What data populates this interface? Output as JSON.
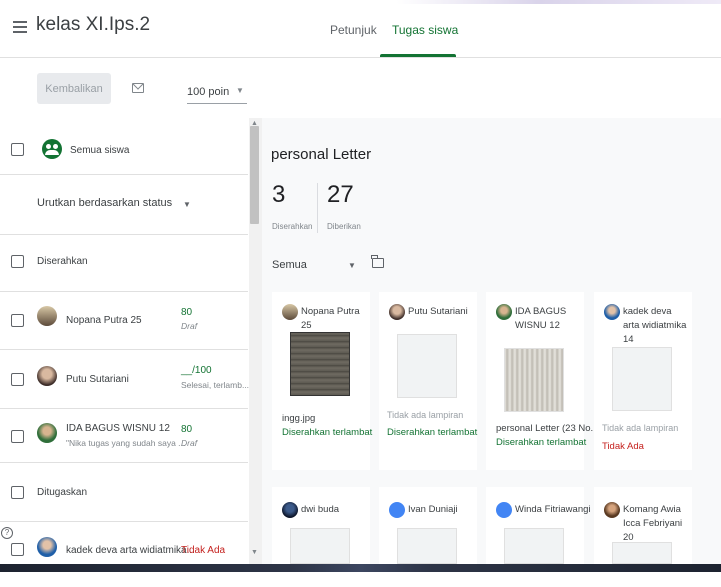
{
  "header": {
    "class_title": "kelas XI.Ips.2",
    "tabs": [
      {
        "label": "Petunjuk",
        "active": false
      },
      {
        "label": "Tugas siswa",
        "active": true
      }
    ]
  },
  "toolbar": {
    "return_label": "Kembalikan",
    "points": "100 poin"
  },
  "left_panel": {
    "all_students_label": "Semua siswa",
    "sort_label": "Urutkan berdasarkan status",
    "section_submitted": "Diserahkan",
    "section_assigned": "Ditugaskan",
    "students": [
      {
        "name": "Nopana Putra 25",
        "sub": "",
        "grade": "80",
        "grade_sub": "Draf"
      },
      {
        "name": "Putu Sutariani",
        "sub": "",
        "grade": "__/100",
        "grade_sub": "Selesai, terlamb..."
      },
      {
        "name": "IDA BAGUS WISNU 12",
        "sub": "\"Nika tugas yang sudah saya ...",
        "grade": "80",
        "grade_sub": "Draf"
      },
      {
        "name": "kadek deva arta widiatmika...",
        "sub": "",
        "grade": "Tidak Ada",
        "grade_sub": ""
      }
    ]
  },
  "right_panel": {
    "assignment_title": "personal Letter",
    "submitted_count": "3",
    "submitted_label": "Diserahkan",
    "assigned_count": "27",
    "assigned_label": "Diberikan",
    "filter": "Semua",
    "cards": [
      {
        "name": "Nopana Putra 25",
        "file": "ingg.jpg",
        "note": "",
        "status": "Diserahkan terlambat",
        "status_color": "#137333"
      },
      {
        "name": "Putu Sutariani",
        "file": "",
        "note": "Tidak ada lampiran",
        "status": "Diserahkan terlambat",
        "status_color": "#137333"
      },
      {
        "name": "IDA BAGUS WISNU 12",
        "file": "personal Letter (23 No...",
        "note": "",
        "status": "Diserahkan terlambat",
        "status_color": "#137333"
      },
      {
        "name": "kadek deva arta widiatmika 14",
        "file": "",
        "note": "Tidak ada lampiran",
        "status": "Tidak Ada",
        "status_color": "#c5221f"
      },
      {
        "name": "dwi buda",
        "file": "",
        "note": "",
        "status": "",
        "status_color": "#137333"
      },
      {
        "name": "Ivan Duniaji",
        "file": "",
        "note": "",
        "status": "",
        "status_color": "#137333"
      },
      {
        "name": "Winda Fitriawangi",
        "file": "",
        "note": "",
        "status": "",
        "status_color": "#137333"
      },
      {
        "name": "Komang Awia Icca Febriyani 20",
        "file": "",
        "note": "",
        "status": "",
        "status_color": "#137333"
      }
    ]
  },
  "colors": {
    "accent": "#137333",
    "late_red": "#c5221f"
  }
}
